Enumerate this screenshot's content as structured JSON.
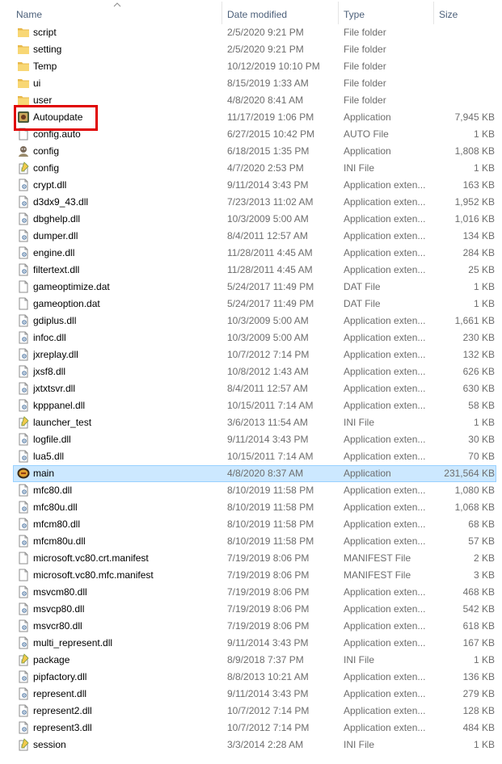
{
  "columns": {
    "name": "Name",
    "date": "Date modified",
    "type": "Type",
    "size": "Size"
  },
  "colors": {
    "selected_bg": "#cce8ff",
    "selected_border": "#99d1ff",
    "highlight": "#e00000",
    "folder": "#f8d775"
  },
  "files": [
    {
      "name": "script",
      "date": "2/5/2020 9:21 PM",
      "type": "File folder",
      "size": "",
      "icon": "folder-icon"
    },
    {
      "name": "setting",
      "date": "2/5/2020 9:21 PM",
      "type": "File folder",
      "size": "",
      "icon": "folder-icon"
    },
    {
      "name": "Temp",
      "date": "10/12/2019 10:10 PM",
      "type": "File folder",
      "size": "",
      "icon": "folder-icon"
    },
    {
      "name": "ui",
      "date": "8/15/2019 1:33 AM",
      "type": "File folder",
      "size": "",
      "icon": "folder-icon"
    },
    {
      "name": "user",
      "date": "4/8/2020 8:41 AM",
      "type": "File folder",
      "size": "",
      "icon": "folder-icon"
    },
    {
      "name": "Autoupdate",
      "date": "11/17/2019 1:06 PM",
      "type": "Application",
      "size": "7,945 KB",
      "icon": "app-autoupdate-icon"
    },
    {
      "name": "config.auto",
      "date": "6/27/2015 10:42 PM",
      "type": "AUTO File",
      "size": "1 KB",
      "icon": "file-icon"
    },
    {
      "name": "config",
      "date": "6/18/2015 1:35 PM",
      "type": "Application",
      "size": "1,808 KB",
      "icon": "app-config-icon"
    },
    {
      "name": "config",
      "date": "4/7/2020 2:53 PM",
      "type": "INI File",
      "size": "1 KB",
      "icon": "ini-file-icon"
    },
    {
      "name": "crypt.dll",
      "date": "9/11/2014 3:43 PM",
      "type": "Application exten...",
      "size": "163 KB",
      "icon": "dll-icon"
    },
    {
      "name": "d3dx9_43.dll",
      "date": "7/23/2013 11:02 AM",
      "type": "Application exten...",
      "size": "1,952 KB",
      "icon": "dll-icon"
    },
    {
      "name": "dbghelp.dll",
      "date": "10/3/2009 5:00 AM",
      "type": "Application exten...",
      "size": "1,016 KB",
      "icon": "dll-icon"
    },
    {
      "name": "dumper.dll",
      "date": "8/4/2011 12:57 AM",
      "type": "Application exten...",
      "size": "134 KB",
      "icon": "dll-icon"
    },
    {
      "name": "engine.dll",
      "date": "11/28/2011 4:45 AM",
      "type": "Application exten...",
      "size": "284 KB",
      "icon": "dll-icon"
    },
    {
      "name": "filtertext.dll",
      "date": "11/28/2011 4:45 AM",
      "type": "Application exten...",
      "size": "25 KB",
      "icon": "dll-icon"
    },
    {
      "name": "gameoptimize.dat",
      "date": "5/24/2017 11:49 PM",
      "type": "DAT File",
      "size": "1 KB",
      "icon": "file-icon"
    },
    {
      "name": "gameoption.dat",
      "date": "5/24/2017 11:49 PM",
      "type": "DAT File",
      "size": "1 KB",
      "icon": "file-icon"
    },
    {
      "name": "gdiplus.dll",
      "date": "10/3/2009 5:00 AM",
      "type": "Application exten...",
      "size": "1,661 KB",
      "icon": "dll-icon"
    },
    {
      "name": "infoc.dll",
      "date": "10/3/2009 5:00 AM",
      "type": "Application exten...",
      "size": "230 KB",
      "icon": "dll-icon"
    },
    {
      "name": "jxreplay.dll",
      "date": "10/7/2012 7:14 PM",
      "type": "Application exten...",
      "size": "132 KB",
      "icon": "dll-icon"
    },
    {
      "name": "jxsf8.dll",
      "date": "10/8/2012 1:43 AM",
      "type": "Application exten...",
      "size": "626 KB",
      "icon": "dll-icon"
    },
    {
      "name": "jxtxtsvr.dll",
      "date": "8/4/2011 12:57 AM",
      "type": "Application exten...",
      "size": "630 KB",
      "icon": "dll-icon"
    },
    {
      "name": "kpppanel.dll",
      "date": "10/15/2011 7:14 AM",
      "type": "Application exten...",
      "size": "58 KB",
      "icon": "dll-icon"
    },
    {
      "name": "launcher_test",
      "date": "3/6/2013 11:54 AM",
      "type": "INI File",
      "size": "1 KB",
      "icon": "ini-file-icon"
    },
    {
      "name": "logfile.dll",
      "date": "9/11/2014 3:43 PM",
      "type": "Application exten...",
      "size": "30 KB",
      "icon": "dll-icon"
    },
    {
      "name": "lua5.dll",
      "date": "10/15/2011 7:14 AM",
      "type": "Application exten...",
      "size": "70 KB",
      "icon": "dll-icon"
    },
    {
      "name": "main",
      "date": "4/8/2020 8:37 AM",
      "type": "Application",
      "size": "231,564 KB",
      "icon": "app-main-icon",
      "selected": true
    },
    {
      "name": "mfc80.dll",
      "date": "8/10/2019 11:58 PM",
      "type": "Application exten...",
      "size": "1,080 KB",
      "icon": "dll-icon"
    },
    {
      "name": "mfc80u.dll",
      "date": "8/10/2019 11:58 PM",
      "type": "Application exten...",
      "size": "1,068 KB",
      "icon": "dll-icon"
    },
    {
      "name": "mfcm80.dll",
      "date": "8/10/2019 11:58 PM",
      "type": "Application exten...",
      "size": "68 KB",
      "icon": "dll-icon"
    },
    {
      "name": "mfcm80u.dll",
      "date": "8/10/2019 11:58 PM",
      "type": "Application exten...",
      "size": "57 KB",
      "icon": "dll-icon"
    },
    {
      "name": "microsoft.vc80.crt.manifest",
      "date": "7/19/2019 8:06 PM",
      "type": "MANIFEST File",
      "size": "2 KB",
      "icon": "file-icon"
    },
    {
      "name": "microsoft.vc80.mfc.manifest",
      "date": "7/19/2019 8:06 PM",
      "type": "MANIFEST File",
      "size": "3 KB",
      "icon": "file-icon"
    },
    {
      "name": "msvcm80.dll",
      "date": "7/19/2019 8:06 PM",
      "type": "Application exten...",
      "size": "468 KB",
      "icon": "dll-icon"
    },
    {
      "name": "msvcp80.dll",
      "date": "7/19/2019 8:06 PM",
      "type": "Application exten...",
      "size": "542 KB",
      "icon": "dll-icon"
    },
    {
      "name": "msvcr80.dll",
      "date": "7/19/2019 8:06 PM",
      "type": "Application exten...",
      "size": "618 KB",
      "icon": "dll-icon"
    },
    {
      "name": "multi_represent.dll",
      "date": "9/11/2014 3:43 PM",
      "type": "Application exten...",
      "size": "167 KB",
      "icon": "dll-icon"
    },
    {
      "name": "package",
      "date": "8/9/2018 7:37 PM",
      "type": "INI File",
      "size": "1 KB",
      "icon": "ini-file-icon"
    },
    {
      "name": "pipfactory.dll",
      "date": "8/8/2013 10:21 AM",
      "type": "Application exten...",
      "size": "136 KB",
      "icon": "dll-icon"
    },
    {
      "name": "represent.dll",
      "date": "9/11/2014 3:43 PM",
      "type": "Application exten...",
      "size": "279 KB",
      "icon": "dll-icon"
    },
    {
      "name": "represent2.dll",
      "date": "10/7/2012 7:14 PM",
      "type": "Application exten...",
      "size": "128 KB",
      "icon": "dll-icon"
    },
    {
      "name": "represent3.dll",
      "date": "10/7/2012 7:14 PM",
      "type": "Application exten...",
      "size": "484 KB",
      "icon": "dll-icon"
    },
    {
      "name": "session",
      "date": "3/3/2014 2:28 AM",
      "type": "INI File",
      "size": "1 KB",
      "icon": "ini-file-icon"
    }
  ]
}
